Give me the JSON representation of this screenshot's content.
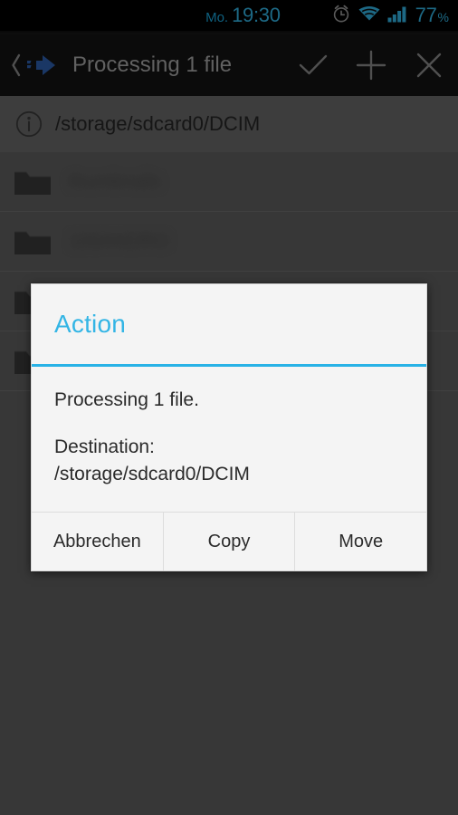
{
  "status_bar": {
    "day": "Mo.",
    "time": "19:30",
    "battery_value": "77",
    "battery_unit": "%",
    "accent_color": "#33b5e5",
    "icons": [
      "alarm-icon",
      "wifi-icon",
      "signal-icon"
    ]
  },
  "action_bar": {
    "up_icon": "back-chevron-icon",
    "app_icon": "blue-arrow-app-icon",
    "title": "Processing 1 file",
    "actions": [
      {
        "name": "confirm-button",
        "icon": "checkmark-icon"
      },
      {
        "name": "add-button",
        "icon": "plus-icon"
      },
      {
        "name": "close-button",
        "icon": "close-x-icon"
      }
    ]
  },
  "path_bar": {
    "icon": "info-icon",
    "path": "/storage/sdcard0/DCIM"
  },
  "file_list": {
    "rows": [
      {
        "icon": "folder-icon",
        "name": "thumbnails",
        "sub": ""
      },
      {
        "icon": "folder-icon",
        "name": "100ANDRO",
        "sub": ""
      },
      {
        "icon": "folder-icon",
        "name": "",
        "sub": ""
      },
      {
        "icon": "folder-icon",
        "name": "",
        "sub": ""
      }
    ]
  },
  "dialog": {
    "title": "Action",
    "title_color": "#33b5e5",
    "message": "Processing 1 file.",
    "destination_label": "Destination:",
    "destination_path": "/storage/sdcard0/DCIM",
    "buttons": [
      {
        "name": "cancel-button",
        "label": "Abbrechen"
      },
      {
        "name": "copy-button",
        "label": "Copy"
      },
      {
        "name": "move-button",
        "label": "Move"
      }
    ]
  }
}
